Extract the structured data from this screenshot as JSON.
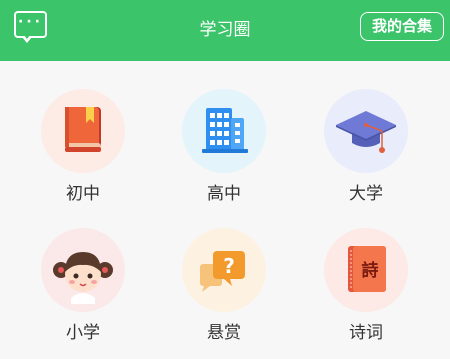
{
  "header": {
    "title": "学习圈",
    "menu_icon": "chat-bubble-dots-icon",
    "collection_label": "我的合集",
    "color": "#3cc46a"
  },
  "categories": [
    {
      "label": "初中",
      "icon": "book-icon",
      "bg": "#fdebe6"
    },
    {
      "label": "高中",
      "icon": "buildings-icon",
      "bg": "#e3f4fb"
    },
    {
      "label": "大学",
      "icon": "graduation-cap-icon",
      "bg": "#e9ecfb"
    },
    {
      "label": "小学",
      "icon": "girl-avatar-icon",
      "bg": "#fbe9e9"
    },
    {
      "label": "悬赏",
      "icon": "question-bubble-icon",
      "bg": "#fdf1e2"
    },
    {
      "label": "诗词",
      "icon": "poetry-book-icon",
      "bg": "#fde9e6"
    }
  ],
  "poetry_book_char": "詩"
}
